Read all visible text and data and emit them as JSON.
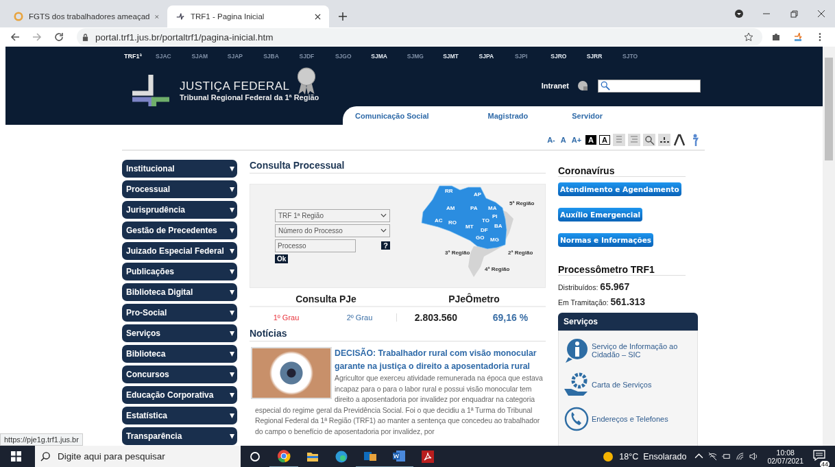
{
  "browser": {
    "tabs": [
      {
        "title": "FGTS dos trabalhadores ameaçad",
        "selected": false
      },
      {
        "title": "TRF1 - Pagina Inicial",
        "selected": true
      }
    ],
    "url": "portal.trf1.jus.br/portaltrf1/pagina-inicial.htm"
  },
  "region_bar": {
    "logo": "TRF1ª",
    "links": [
      {
        "label": "SJAC",
        "active": false
      },
      {
        "label": "SJAM",
        "active": false
      },
      {
        "label": "SJAP",
        "active": false
      },
      {
        "label": "SJBA",
        "active": false
      },
      {
        "label": "SJDF",
        "active": false
      },
      {
        "label": "SJGO",
        "active": false
      },
      {
        "label": "SJMA",
        "active": true
      },
      {
        "label": "SJMG",
        "active": false
      },
      {
        "label": "SJMT",
        "active": true
      },
      {
        "label": "SJPA",
        "active": true
      },
      {
        "label": "SJPI",
        "active": false
      },
      {
        "label": "SJRO",
        "active": true
      },
      {
        "label": "SJRR",
        "active": true
      },
      {
        "label": "SJTO",
        "active": false
      }
    ]
  },
  "header": {
    "title": "JUSTIÇA FEDERAL",
    "subtitle": "Tribunal Regional Federal da 1ª Região",
    "intranet": "Intranet",
    "nav": [
      "Comunicação Social",
      "Magistrado",
      "Servidor"
    ]
  },
  "font_tools": [
    {
      "label": "A-",
      "kind": "text"
    },
    {
      "label": "A",
      "kind": "text"
    },
    {
      "label": "A+",
      "kind": "text"
    },
    {
      "label": "A",
      "kind": "dark"
    },
    {
      "label": "A",
      "kind": "light"
    }
  ],
  "sidebar": {
    "items": [
      "Institucional",
      "Processual",
      "Jurisprudência",
      "Gestão de Precedentes",
      "Juizado Especial Federal",
      "Publicações",
      "Biblioteca Digital",
      "Pro-Social",
      "Serviços",
      "Biblioteca",
      "Concursos",
      "Educação Corporativa",
      "Estatística",
      "Transparência"
    ]
  },
  "consulta": {
    "title": "Consulta Processual",
    "selects": [
      "TRF 1ª Região",
      "Número do Processo"
    ],
    "placeholder": "Processo",
    "help": "?",
    "submit": "Ok",
    "map_labels": [
      "RR",
      "AP",
      "AM",
      "PA",
      "MA",
      "PI",
      "AC",
      "RO",
      "MT",
      "TO",
      "BA",
      "DF",
      "GO",
      "MG",
      "5ª Região",
      "3ª Região",
      "2ª Região",
      "4ª Região"
    ]
  },
  "pje": {
    "title": "Consulta PJe",
    "links": [
      {
        "label": "1º Grau",
        "color": "#e8313a"
      },
      {
        "label": "2º Grau",
        "color": "#3a6ea5"
      }
    ]
  },
  "pjeometro": {
    "title": "PJeÔmetro",
    "count": "2.803.560",
    "percent": "69,16 %"
  },
  "news": {
    "title": "Notícias",
    "headline": "DECISÃO: Trabalhador rural com visão monocular garante na justiça o direito a aposentadoria rural",
    "body": "Agricultor que exerceu atividade remunerada na época que estava incapaz para o para o labor rural e possui visão monocular tem direito a aposentadoria por invalidez por enquadrar na categoria especial do regime geral da Previdência Social. Foi o que decidiu a 1ª Turma do Tribunal Regional Federal da 1ª Região (TRF1) ao manter a sentença que concedeu ao trabalhador do campo o benefício de aposentadoria por invalidez, por"
  },
  "coronavirus": {
    "title": "Coronavírus",
    "buttons": [
      "Atendimento e Agendamento",
      "Auxílio Emergencial",
      "Normas e Informações"
    ]
  },
  "processometro": {
    "title": "Processômetro TRF1",
    "stats": [
      {
        "label": "Distribuídos:",
        "value": "65.967"
      },
      {
        "label": "Em Tramitação:",
        "value": "561.313"
      }
    ]
  },
  "servicos": {
    "title": "Serviços",
    "items": [
      {
        "label": "Serviço de Informação ao Cidadão – SIC",
        "kind": "info"
      },
      {
        "label": "Carta de Serviços",
        "kind": "hand"
      },
      {
        "label": "Endereços e Telefones",
        "kind": "phone"
      }
    ]
  },
  "status_link": "https://pje1g.trf1.jus.br",
  "taskbar": {
    "search": "Digite aqui para pesquisar",
    "weather": "18°C  Ensolarado",
    "time": "10:08",
    "date": "02/07/2021",
    "notifications": "44"
  }
}
